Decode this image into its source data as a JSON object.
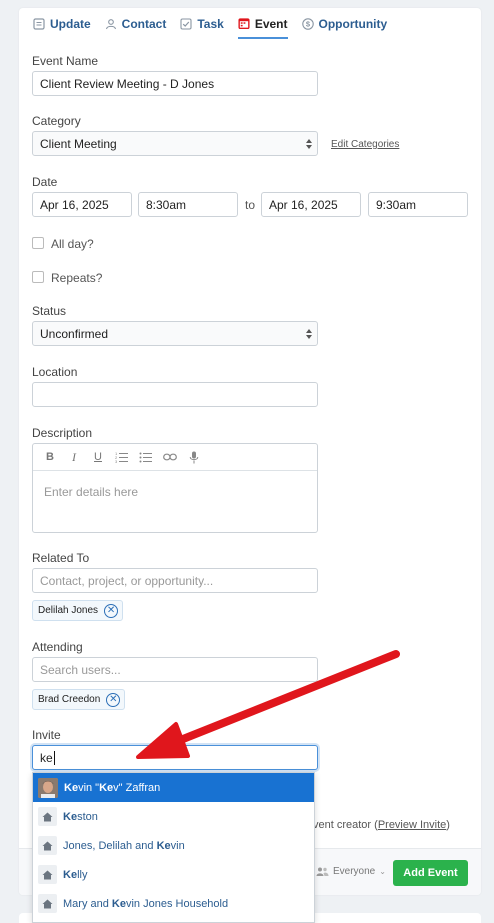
{
  "tabs": [
    {
      "label": "Update",
      "icon": "update-icon"
    },
    {
      "label": "Contact",
      "icon": "contact-icon"
    },
    {
      "label": "Task",
      "icon": "task-checkbox-icon"
    },
    {
      "label": "Event",
      "icon": "calendar-icon",
      "active": true
    },
    {
      "label": "Opportunity",
      "icon": "dollar-icon"
    }
  ],
  "event_name": {
    "label": "Event Name",
    "value": "Client Review Meeting - D Jones"
  },
  "category": {
    "label": "Category",
    "value": "Client Meeting",
    "edit_link": "Edit Categories"
  },
  "date": {
    "label": "Date",
    "start_date": "Apr 16, 2025",
    "start_time": "8:30am",
    "separator": "to",
    "end_date": "Apr 16, 2025",
    "end_time": "9:30am"
  },
  "all_day": {
    "label": "All day?"
  },
  "repeats": {
    "label": "Repeats?"
  },
  "status": {
    "label": "Status",
    "value": "Unconfirmed"
  },
  "location": {
    "label": "Location",
    "value": ""
  },
  "description": {
    "label": "Description",
    "placeholder": "Enter details here",
    "toolbar": [
      "B",
      "I",
      "U"
    ]
  },
  "related_to": {
    "label": "Related To",
    "placeholder": "Contact, project, or opportunity...",
    "chip": "Delilah Jones"
  },
  "attending": {
    "label": "Attending",
    "placeholder": "Search users...",
    "chip": "Brad Creedon"
  },
  "invite": {
    "label": "Invite",
    "value": "ke",
    "suggestions": [
      {
        "before": "",
        "match": "Ke",
        "after": "vin \"",
        "match2": "Ke",
        "after2": "v\" Zaffran",
        "type": "person"
      },
      {
        "before": "",
        "match": "Ke",
        "after": "ston",
        "match2": "",
        "after2": "",
        "type": "household"
      },
      {
        "before": "Jones, Delilah and ",
        "match": "Ke",
        "after": "vin",
        "match2": "",
        "after2": "",
        "type": "household"
      },
      {
        "before": "",
        "match": "Ke",
        "after": "lly",
        "match2": "",
        "after2": "",
        "type": "household"
      },
      {
        "before": "Mary and ",
        "match": "Ke",
        "after": "vin Jones Household",
        "match2": "",
        "after2": "",
        "type": "household"
      }
    ]
  },
  "footer": {
    "creator_text": "vent creator (",
    "preview_link": "Preview Invite",
    "close_paren": ")"
  },
  "audience": "Everyone",
  "submit_label": "Add Event",
  "colors": {
    "accent": "#1872d2",
    "success": "#2bb24c",
    "arrow": "#e0161c",
    "link": "#2c5d90"
  }
}
